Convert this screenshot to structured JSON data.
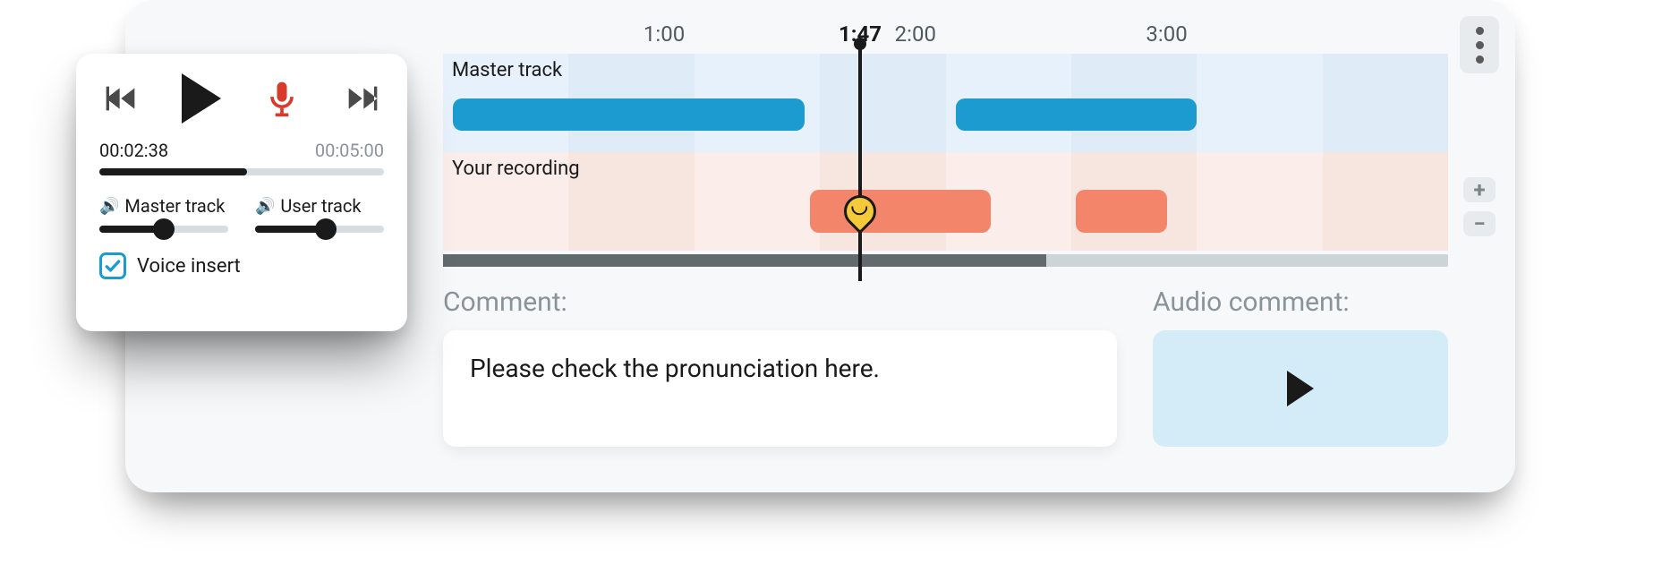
{
  "timeline": {
    "ticks": [
      "1:00",
      "2:00",
      "3:00"
    ],
    "tick_positions_pct": [
      22,
      47,
      72
    ],
    "playhead_label": "1:47",
    "playhead_pct": 41.5,
    "scrub_fill_pct": 60,
    "master": {
      "label": "Master track",
      "clips": [
        {
          "left_pct": 1,
          "width_pct": 35
        },
        {
          "left_pct": 51,
          "width_pct": 24
        }
      ]
    },
    "user": {
      "label": "Your recording",
      "clips": [
        {
          "left_pct": 36.5,
          "width_pct": 18
        },
        {
          "left_pct": 63,
          "width_pct": 9
        }
      ],
      "comment_marker_pct": 41.5
    }
  },
  "zoom": {
    "in_glyph": "+",
    "out_glyph": "−"
  },
  "comment": {
    "label": "Comment:",
    "text": "Please check the pronunciation here.",
    "audio_label": "Audio comment:"
  },
  "player": {
    "current_time": "00:02:38",
    "total_time": "00:05:00",
    "progress_pct": 52,
    "master": {
      "label": "Master track",
      "level_pct": 50
    },
    "user": {
      "label": "User track",
      "level_pct": 55
    },
    "voice_insert_label": "Voice insert",
    "voice_insert_checked": true
  },
  "icons": {
    "kebab": "more-vertical",
    "skip_back": "skip-back",
    "play": "play",
    "record": "microphone",
    "skip_fwd": "skip-forward",
    "speaker": "volume"
  }
}
